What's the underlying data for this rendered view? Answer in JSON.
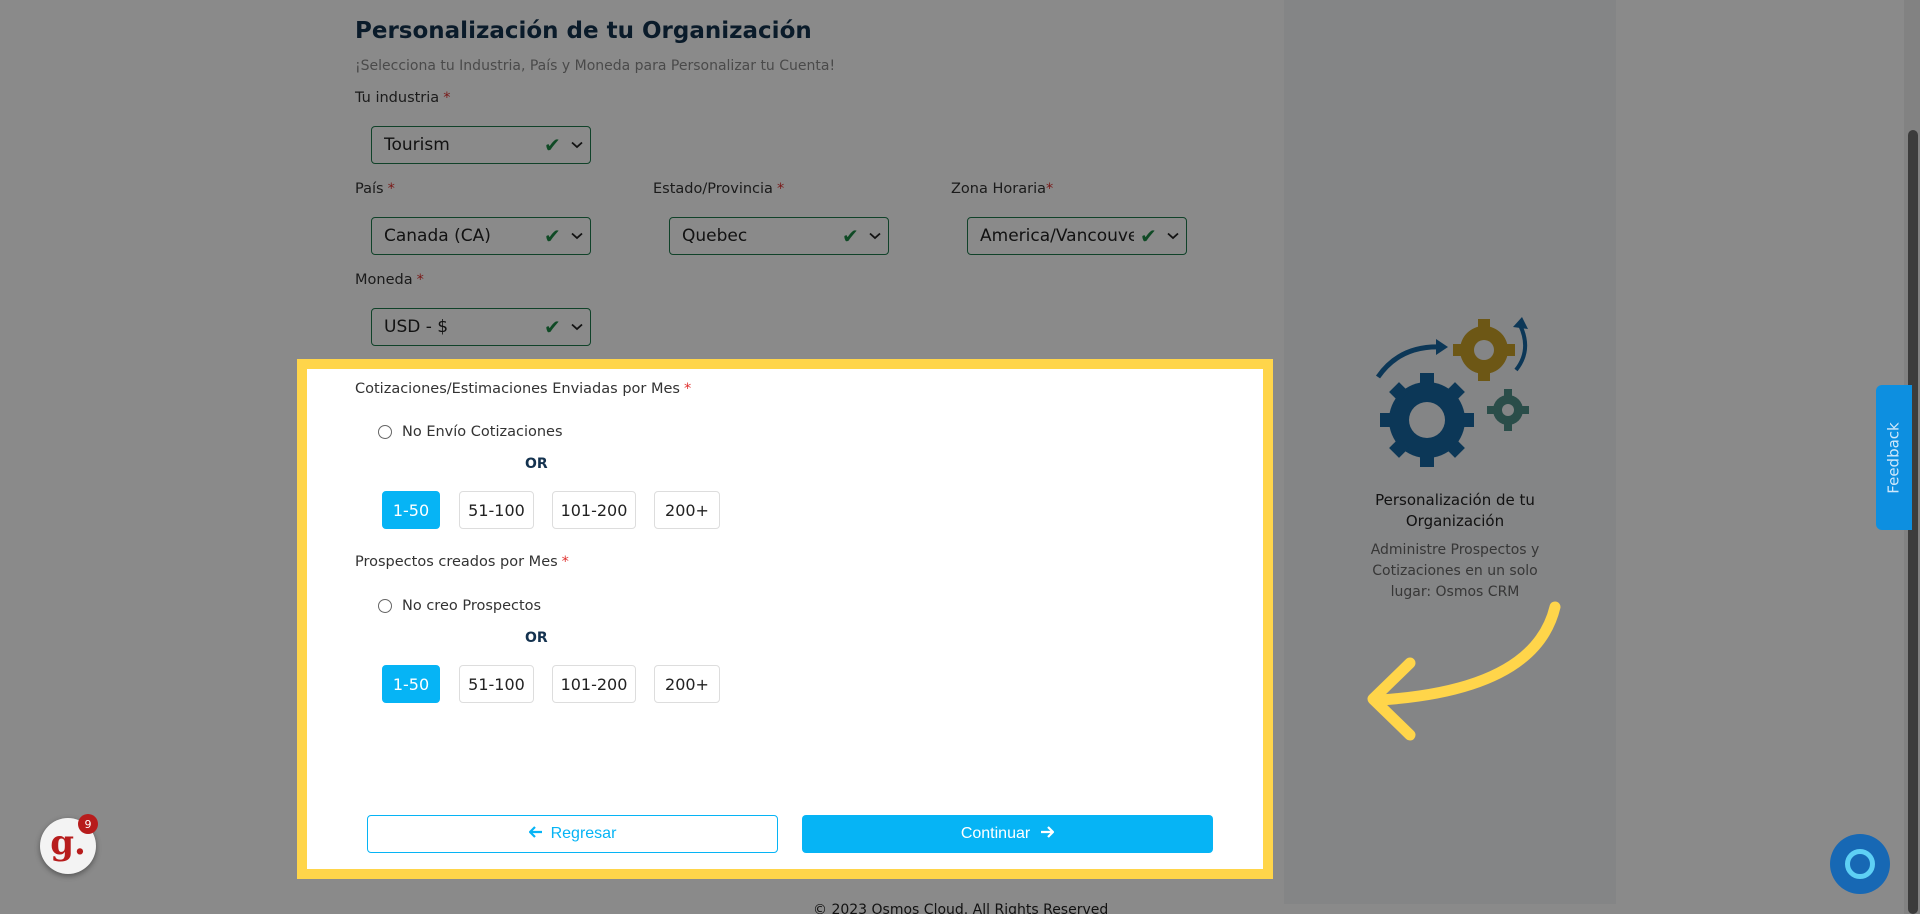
{
  "form": {
    "title": "Personalización de tu Organización",
    "subtitle": "¡Selecciona tu Industria, País y Moneda para Personalizar tu Cuenta!",
    "industry": {
      "label": "Tu industria",
      "required": "*",
      "value": "Tourism"
    },
    "country": {
      "label": "País",
      "required": "*",
      "value": "Canada (CA)"
    },
    "state": {
      "label": "Estado/Provincia",
      "required": "*",
      "value": "Quebec"
    },
    "timezone": {
      "label": "Zona Horaria",
      "required": "*",
      "value": "America/Vancouver"
    },
    "currency": {
      "label": "Moneda",
      "required": "*",
      "value": "USD - $"
    }
  },
  "quotes": {
    "label": "Cotizaciones/Estimaciones Enviadas por Mes",
    "required": "*",
    "radio_label": "No Envío Cotizaciones",
    "or": "OR",
    "options": [
      "1-50",
      "51-100",
      "101-200",
      "200+"
    ],
    "selected": "1-50"
  },
  "leads": {
    "label": "Prospectos creados por Mes",
    "required": "*",
    "radio_label": "No creo Prospectos",
    "or": "OR",
    "options": [
      "1-50",
      "51-100",
      "101-200",
      "200+"
    ],
    "selected": "1-50"
  },
  "buttons": {
    "back": "Regresar",
    "next": "Continuar"
  },
  "side_panel": {
    "title": "Personalización de tu Organización",
    "description": "Administre Prospectos y Cotizaciones en un solo lugar: Osmos CRM"
  },
  "footer": {
    "text": "© 2023 Osmos Cloud. All Rights Reserved"
  },
  "feedback": {
    "label": "Feedback"
  },
  "badge": {
    "letter": "g.",
    "count": "9"
  },
  "colors": {
    "accent": "#06b4f5",
    "highlight": "#ffd54a",
    "valid": "#1d8a45",
    "title": "#14324f"
  },
  "icons": {
    "valid": "checkmark-icon",
    "dropdown": "chevron-down-icon",
    "back": "arrow-left-icon",
    "next": "arrow-right-icon",
    "illustration": "gears-icon",
    "pointer": "curved-arrow-icon",
    "chat": "chat-icon"
  }
}
